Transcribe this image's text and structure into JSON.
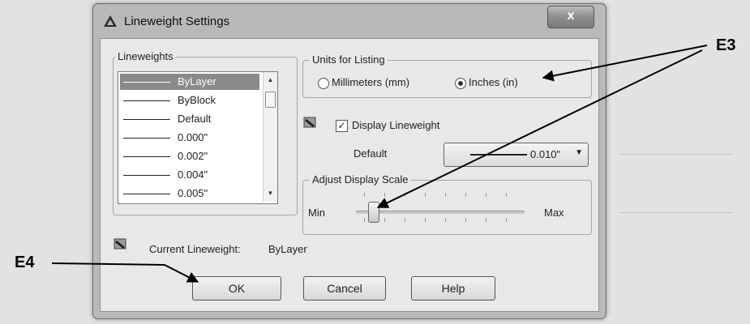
{
  "dialog": {
    "title": "Lineweight Settings",
    "close_label": "x"
  },
  "lineweights": {
    "group_label": "Lineweights",
    "items": [
      {
        "label": "ByLayer",
        "selected": true
      },
      {
        "label": "ByBlock",
        "selected": false
      },
      {
        "label": "Default",
        "selected": false
      },
      {
        "label": "0.000\"",
        "selected": false
      },
      {
        "label": "0.002\"",
        "selected": false
      },
      {
        "label": "0.004\"",
        "selected": false
      },
      {
        "label": "0.005\"",
        "selected": false
      }
    ]
  },
  "units": {
    "group_label": "Units for Listing",
    "options": [
      {
        "label": "Millimeters (mm)",
        "selected": false
      },
      {
        "label": "Inches (in)",
        "selected": true
      }
    ]
  },
  "display": {
    "checkbox_label": "Display Lineweight",
    "checked": true,
    "default_label": "Default",
    "default_value": "0.010\""
  },
  "scale": {
    "group_label": "Adjust Display Scale",
    "min_label": "Min",
    "max_label": "Max",
    "position": 0.1
  },
  "current": {
    "label": "Current Lineweight:",
    "value": "ByLayer"
  },
  "buttons": {
    "ok": "OK",
    "cancel": "Cancel",
    "help": "Help"
  },
  "callouts": {
    "e3": "E3",
    "e4": "E4"
  }
}
